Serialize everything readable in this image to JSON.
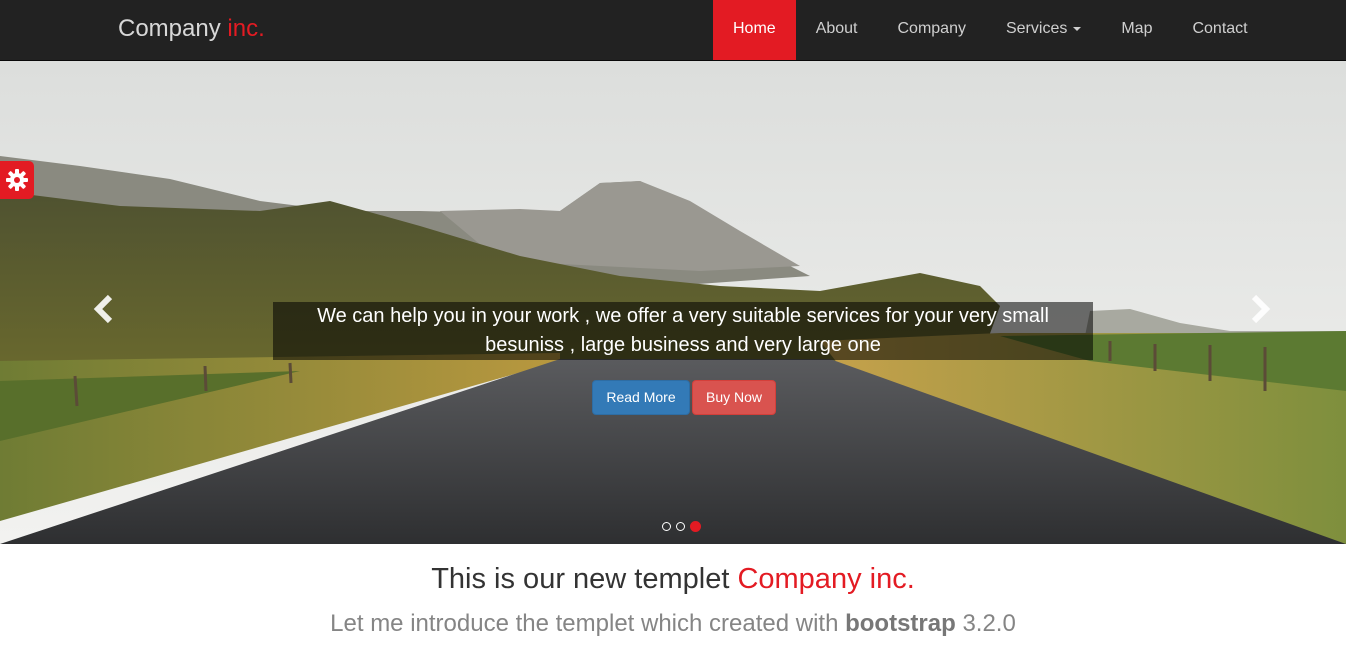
{
  "navbar": {
    "brand_main": "Company",
    "brand_accent": "inc.",
    "items": [
      {
        "label": "Home",
        "active": true
      },
      {
        "label": "About"
      },
      {
        "label": "Company"
      },
      {
        "label": "Services",
        "dropdown": true
      },
      {
        "label": "Map"
      },
      {
        "label": "Contact"
      }
    ]
  },
  "hero": {
    "caption": "We can help you in your work , we offer a very suitable services for your very small besuniss , large business and very large one",
    "read_more": "Read More",
    "buy_now": "Buy Now",
    "slides": 3,
    "active_slide": 3,
    "prev_icon": "chevron-left-icon",
    "next_icon": "chevron-right-icon",
    "settings_icon": "gear-icon"
  },
  "intro": {
    "title_main": "This is our new templet",
    "title_accent": "Company inc.",
    "subtitle_before": "Let me introduce the templet which created with",
    "subtitle_bold": "bootstrap",
    "subtitle_after": "3.2.0"
  },
  "colors": {
    "accent": "#e31b23",
    "navbar_bg": "#222222",
    "primary_button": "#337ab7",
    "danger_button": "#d9534f"
  }
}
